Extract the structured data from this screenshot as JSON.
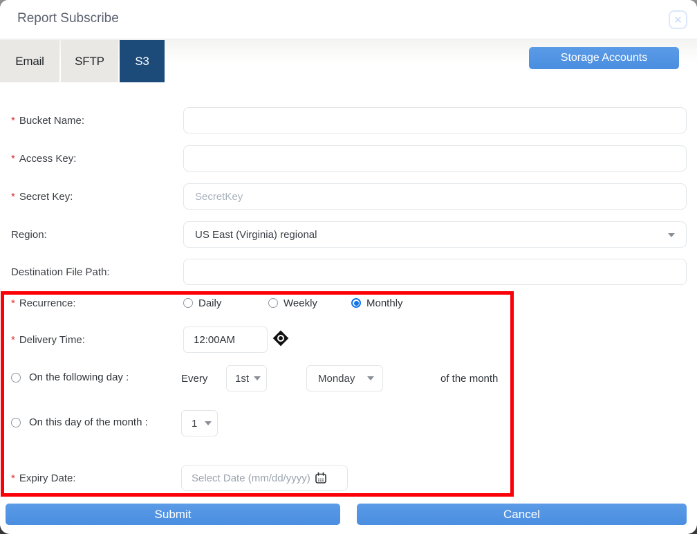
{
  "dialog": {
    "title": "Report Subscribe",
    "close_glyph": "✕"
  },
  "tabs": {
    "items": [
      {
        "label": "Email"
      },
      {
        "label": "SFTP"
      },
      {
        "label": "S3"
      }
    ],
    "active": "S3"
  },
  "toolbar": {
    "storage_accounts_label": "Storage Accounts"
  },
  "form": {
    "bucket_name": {
      "label": "Bucket Name:",
      "required": "*",
      "value": ""
    },
    "access_key": {
      "label": "Access Key:",
      "required": "*",
      "value": ""
    },
    "secret_key": {
      "label": "Secret Key:",
      "required": "*",
      "placeholder": "SecretKey"
    },
    "region": {
      "label": "Region:",
      "value": "US East (Virginia) regional"
    },
    "destination_file_path": {
      "label": "Destination File Path:",
      "value": ""
    },
    "recurrence": {
      "label": "Recurrence:",
      "required": "*",
      "options": [
        {
          "label": "Daily",
          "selected": false
        },
        {
          "label": "Weekly",
          "selected": false
        },
        {
          "label": "Monthly",
          "selected": true
        }
      ]
    },
    "delivery_time": {
      "label": "Delivery Time:",
      "required": "*",
      "value": "12:00AM"
    },
    "following_day": {
      "label": "On the following day :",
      "selected": false,
      "every_label": "Every",
      "ordinal": "1st",
      "weekday": "Monday",
      "suffix": "of the month"
    },
    "day_of_month": {
      "label": "On this day of the month :",
      "selected": false,
      "day": "1"
    },
    "expiry_date": {
      "label": "Expiry Date:",
      "required": "*",
      "placeholder": "Select Date (mm/dd/yyyy)"
    }
  },
  "buttons": {
    "submit": "Submit",
    "cancel": "Cancel"
  },
  "colors": {
    "accent_blue": "#4a90e2",
    "active_tab_navy": "#1d4b79",
    "highlight_red": "#fb0007",
    "radio_selected_blue": "#1474e6",
    "required_red": "#e02b2b"
  }
}
